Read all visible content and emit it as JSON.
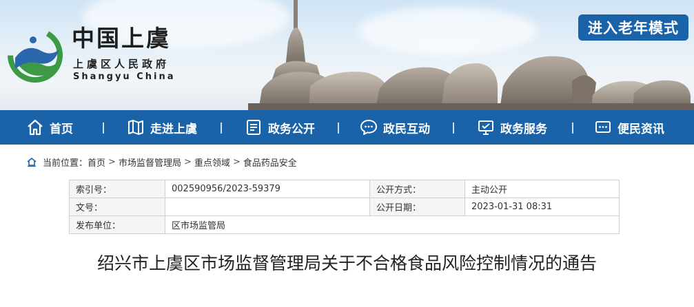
{
  "header": {
    "site_name": "中国上虞",
    "site_sub": "上虞区人民政府",
    "site_en": "Shangyu China",
    "elder_mode": "进入老年模式"
  },
  "nav": {
    "items": [
      {
        "label": "首页",
        "icon": "home-icon"
      },
      {
        "label": "走进上虞",
        "icon": "book-map-icon"
      },
      {
        "label": "政务公开",
        "icon": "document-icon"
      },
      {
        "label": "政民互动",
        "icon": "chat-icon"
      },
      {
        "label": "政务服务",
        "icon": "monitor-icon"
      },
      {
        "label": "便民资讯",
        "icon": "message-icon"
      }
    ]
  },
  "breadcrumb": {
    "prefix": "当前位置：",
    "items": [
      "首页",
      "市场监督管理局",
      "重点领域",
      "食品药品安全"
    ],
    "separator": ">"
  },
  "info": {
    "index_label": "索引号：",
    "index_value": "002590956/2023-59379",
    "public_mode_label": "公开方式：",
    "public_mode_value": "主动公开",
    "doc_no_label": "文号：",
    "doc_no_value": "",
    "public_date_label": "公开日期：",
    "public_date_value": "2023-01-31 08:31",
    "publisher_label": "发布单位：",
    "publisher_value": "区市场监管局"
  },
  "article": {
    "title": "绍兴市上虞区市场监督管理局关于不合格食品风险控制情况的通告"
  },
  "colors": {
    "nav_blue": "#1a63a8",
    "logo_green": "#3c9a45",
    "logo_blue": "#2a67ad"
  }
}
